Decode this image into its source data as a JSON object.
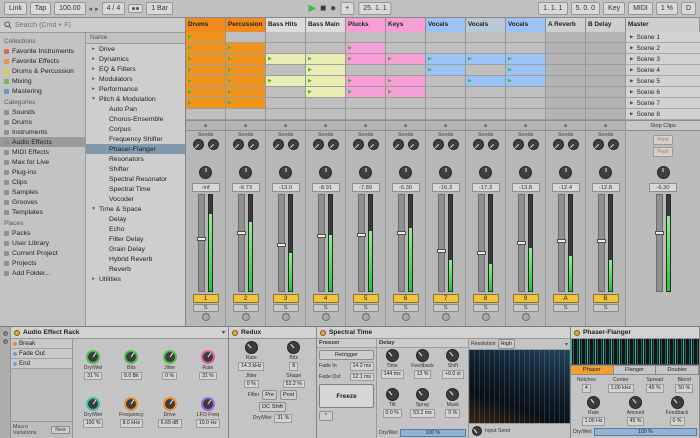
{
  "transport": {
    "link": "Link",
    "tap": "Tap",
    "tempo": "100.00",
    "nudge_down": "◂",
    "nudge_up": "▸",
    "time_sig": "4 / 4",
    "quantize_menu": "1 Bar",
    "play": "▶",
    "stop": "■",
    "record": "●",
    "overdub": "+",
    "arrangement_position": "25. 1. 1",
    "loop_start": "1. 1. 1",
    "loop_length": "5. 0. 0",
    "key_label": "Key",
    "midi_label": "MIDI",
    "cpu": "1 %",
    "disk": "D"
  },
  "browser": {
    "search_placeholder": "Search (Cmd + F)",
    "collections_label": "Collections",
    "collections": [
      {
        "label": "Favorite Instruments",
        "c": "#d66a50"
      },
      {
        "label": "Favorite Effects",
        "c": "#e89637"
      },
      {
        "label": "Drums & Percussion",
        "c": "#ddc93f"
      },
      {
        "label": "Mixing",
        "c": "#7fb25a"
      },
      {
        "label": "Mastering",
        "c": "#5e9bc8"
      }
    ],
    "categories_label": "Categories",
    "categories": [
      {
        "label": "Sounds",
        "bg": ""
      },
      {
        "label": "Drums",
        "bg": ""
      },
      {
        "label": "Instruments",
        "bg": ""
      },
      {
        "label": "Audio Effects",
        "bg": "#9a9a9a"
      },
      {
        "label": "MIDI Effects",
        "bg": ""
      },
      {
        "label": "Max for Live",
        "bg": ""
      },
      {
        "label": "Plug-ins",
        "bg": ""
      },
      {
        "label": "Clips",
        "bg": ""
      },
      {
        "label": "Samples",
        "bg": ""
      },
      {
        "label": "Grooves",
        "bg": ""
      },
      {
        "label": "Templates",
        "bg": ""
      }
    ],
    "places_label": "Places",
    "places": [
      {
        "label": "Packs"
      },
      {
        "label": "User Library"
      },
      {
        "label": "Current Project"
      },
      {
        "label": "Projects"
      },
      {
        "label": "Add Folder..."
      }
    ],
    "name_header": "Name",
    "tree": [
      {
        "label": "Drive",
        "arrow": "▸",
        "pad": "4px",
        "bg": ""
      },
      {
        "label": "Dynamics",
        "arrow": "▸",
        "pad": "4px",
        "bg": ""
      },
      {
        "label": "EQ & Filters",
        "arrow": "▸",
        "pad": "4px",
        "bg": ""
      },
      {
        "label": "Modulators",
        "arrow": "▸",
        "pad": "4px",
        "bg": ""
      },
      {
        "label": "Performance",
        "arrow": "▸",
        "pad": "4px",
        "bg": ""
      },
      {
        "label": "Pitch & Modulation",
        "arrow": "▾",
        "pad": "4px",
        "bg": ""
      },
      {
        "label": "Auto Pan",
        "arrow": "",
        "pad": "14px",
        "bg": ""
      },
      {
        "label": "Chorus-Ensemble",
        "arrow": "",
        "pad": "14px",
        "bg": ""
      },
      {
        "label": "Corpus",
        "arrow": "",
        "pad": "14px",
        "bg": ""
      },
      {
        "label": "Frequency Shifter",
        "arrow": "",
        "pad": "14px",
        "bg": ""
      },
      {
        "label": "Phaser-Flanger",
        "arrow": "",
        "pad": "14px",
        "bg": "#8298ad"
      },
      {
        "label": "Resonators",
        "arrow": "",
        "pad": "14px",
        "bg": ""
      },
      {
        "label": "Shifter",
        "arrow": "",
        "pad": "14px",
        "bg": ""
      },
      {
        "label": "Spectral Resonator",
        "arrow": "",
        "pad": "14px",
        "bg": ""
      },
      {
        "label": "Spectral Time",
        "arrow": "",
        "pad": "14px",
        "bg": ""
      },
      {
        "label": "Vocoder",
        "arrow": "",
        "pad": "14px",
        "bg": ""
      },
      {
        "label": "Time & Space",
        "arrow": "▾",
        "pad": "4px",
        "bg": ""
      },
      {
        "label": "Delay",
        "arrow": "",
        "pad": "14px",
        "bg": ""
      },
      {
        "label": "Echo",
        "arrow": "",
        "pad": "14px",
        "bg": ""
      },
      {
        "label": "Filter Delay",
        "arrow": "",
        "pad": "14px",
        "bg": ""
      },
      {
        "label": "Grain Delay",
        "arrow": "",
        "pad": "14px",
        "bg": ""
      },
      {
        "label": "Hybrid Reverb",
        "arrow": "",
        "pad": "14px",
        "bg": ""
      },
      {
        "label": "Reverb",
        "arrow": "",
        "pad": "14px",
        "bg": ""
      },
      {
        "label": "Utilities",
        "arrow": "▸",
        "pad": "4px",
        "bg": ""
      }
    ]
  },
  "session": {
    "master_header": "Master",
    "stop_clips_label": "Stop Clips",
    "tracks": [
      {
        "name": "Drums",
        "hbg": "#f08a1d",
        "clips": [
          {
            "bg": "#f0941e",
            "sym": "▶"
          },
          {
            "bg": "#f0941e",
            "sym": "▶"
          },
          {
            "bg": "#f0941e",
            "sym": "▶"
          },
          {
            "bg": "#f0941e",
            "sym": "▶"
          },
          {
            "bg": "#f0941e",
            "sym": "▶"
          },
          {
            "bg": "#f0941e",
            "sym": "▶"
          },
          {
            "bg": "#f0941e",
            "sym": "▶"
          },
          {}
        ]
      },
      {
        "name": "Percussion",
        "hbg": "#f08a1d",
        "clips": [
          {},
          {
            "bg": "#f0941e",
            "sym": "▶"
          },
          {
            "bg": "#f0941e",
            "sym": "▶"
          },
          {
            "bg": "#f0941e",
            "sym": "▶"
          },
          {
            "bg": "#f0941e",
            "sym": "▶"
          },
          {
            "bg": "#f0941e",
            "sym": "▶"
          },
          {
            "bg": "#f0941e",
            "sym": "▶"
          },
          {}
        ]
      },
      {
        "name": "Bass Hits",
        "hbg": "#dcdcdc",
        "clips": [
          {},
          {},
          {
            "bg": "#e9ecb3",
            "sym": "▶"
          },
          {},
          {
            "bg": "#e9ecb3",
            "sym": "▶"
          },
          {},
          {},
          {}
        ]
      },
      {
        "name": "Bass Main",
        "hbg": "#dcdcdc",
        "clips": [
          {},
          {},
          {
            "bg": "#e9ecb3",
            "sym": "▶"
          },
          {
            "bg": "#e9ecb3",
            "sym": "▶"
          },
          {
            "bg": "#e9ecb3",
            "sym": "▶"
          },
          {
            "bg": "#e9ecb3",
            "sym": "▶"
          },
          {},
          {}
        ]
      },
      {
        "name": "Plucks",
        "hbg": "#f59fd4",
        "clips": [
          {},
          {
            "bg": "#f59fd4",
            "sym": "▶"
          },
          {
            "bg": "#f59fd4",
            "sym": "▶"
          },
          {},
          {
            "bg": "#f59fd4",
            "sym": "▶"
          },
          {
            "bg": "#f59fd4",
            "sym": "▶"
          },
          {},
          {}
        ]
      },
      {
        "name": "Keys",
        "hbg": "#f59fd4",
        "clips": [
          {},
          {},
          {
            "bg": "#f59fd4",
            "sym": "▶"
          },
          {},
          {
            "bg": "#f59fd4",
            "sym": "▶"
          },
          {
            "bg": "#f59fd4",
            "sym": "▶"
          },
          {},
          {}
        ]
      },
      {
        "name": "Vocals",
        "hbg": "#9cc3f5",
        "clips": [
          {},
          {},
          {
            "bg": "#9cc3f5",
            "sym": "▶"
          },
          {
            "bg": "#9cc3f5",
            "sym": "▶"
          },
          {},
          {},
          {},
          {}
        ]
      },
      {
        "name": "Vocals",
        "hbg": "#b9c7d6",
        "clips": [
          {},
          {},
          {
            "bg": "#9cc3f5",
            "sym": "▶"
          },
          {},
          {
            "bg": "#9cc3f5",
            "sym": "▶"
          },
          {},
          {},
          {}
        ]
      },
      {
        "name": "Vocals",
        "hbg": "#9cc3f5",
        "clips": [
          {},
          {},
          {
            "bg": "#9cc3f5",
            "sym": "▶"
          },
          {
            "bg": "#9cc3f5",
            "sym": "▶"
          },
          {
            "bg": "#9cc3f5",
            "sym": "▶"
          },
          {},
          {},
          {}
        ]
      },
      {
        "name": "A Reverb",
        "hbg": "#cfcfcf",
        "clips": [
          {
            "bg": "#b3b3b3"
          },
          {
            "bg": "#b3b3b3"
          },
          {
            "bg": "#b3b3b3"
          },
          {
            "bg": "#b3b3b3"
          },
          {
            "bg": "#b3b3b3"
          },
          {
            "bg": "#b3b3b3"
          },
          {
            "bg": "#b3b3b3"
          },
          {
            "bg": "#b3b3b3"
          }
        ]
      },
      {
        "name": "B Delay",
        "hbg": "#cfcfcf",
        "clips": [
          {
            "bg": "#b3b3b3"
          },
          {
            "bg": "#b3b3b3"
          },
          {
            "bg": "#b3b3b3"
          },
          {
            "bg": "#b3b3b3"
          },
          {
            "bg": "#b3b3b3"
          },
          {
            "bg": "#b3b3b3"
          },
          {
            "bg": "#b3b3b3"
          },
          {
            "bg": "#b3b3b3"
          }
        ]
      }
    ],
    "scenes": [
      {
        "label": "Scene 1"
      },
      {
        "label": "Scene 2"
      },
      {
        "label": "Scene 3"
      },
      {
        "label": "Scene 4"
      },
      {
        "label": "Scene 5"
      },
      {
        "label": "Scene 6"
      },
      {
        "label": "Scene 7"
      },
      {
        "label": "Scene 8"
      }
    ]
  },
  "mixer": {
    "sends_label": "Sends",
    "solo_label": "S",
    "strips": [
      {
        "num": "1",
        "db": "-Inf",
        "meter": "80%",
        "fader": "52%",
        "armvis": "visible"
      },
      {
        "num": "2",
        "db": "-6.73",
        "meter": "72%",
        "fader": "58%",
        "armvis": "visible"
      },
      {
        "num": "3",
        "db": "-13.0",
        "meter": "40%",
        "fader": "46%",
        "armvis": "visible"
      },
      {
        "num": "4",
        "db": "-8.91",
        "meter": "58%",
        "fader": "55%",
        "armvis": "visible"
      },
      {
        "num": "5",
        "db": "-7.89",
        "meter": "62%",
        "fader": "56%",
        "armvis": "visible"
      },
      {
        "num": "6",
        "db": "-6.30",
        "meter": "66%",
        "fader": "58%",
        "armvis": "visible"
      },
      {
        "num": "7",
        "db": "-16.3",
        "meter": "32%",
        "fader": "40%",
        "armvis": "visible"
      },
      {
        "num": "8",
        "db": "-17.3",
        "meter": "28%",
        "fader": "38%",
        "armvis": "visible"
      },
      {
        "num": "9",
        "db": "-13.8",
        "meter": "45%",
        "fader": "48%",
        "armvis": "visible"
      },
      {
        "num": "A",
        "db": "-12.4",
        "meter": "36%",
        "fader": "50%",
        "armvis": "hidden"
      },
      {
        "num": "B",
        "db": "-12.8",
        "meter": "32%",
        "fader": "50%",
        "armvis": "hidden"
      }
    ],
    "master": {
      "post_a": "Post",
      "post_b": "Post",
      "db": "-6.30",
      "meter": "78%",
      "fader": "58%"
    }
  },
  "detail": {
    "rack": {
      "title": "Audio Effect Rack",
      "chains": [
        {
          "name": "Break",
          "dot": "#e8883a"
        },
        {
          "name": "Fade Out",
          "dot": "#6aa1d8"
        },
        {
          "name": "End",
          "dot": "#6aa1d8"
        }
      ],
      "macro_variations_label": "Macro Variations",
      "variation_new_label": "New",
      "macros": [
        {
          "label": "Dry/Wet",
          "value": "31 %",
          "c": "#4cbf4c"
        },
        {
          "label": "Bits",
          "value": "8.0 Bit",
          "c": "#4cbf4c"
        },
        {
          "label": "Jitter",
          "value": "0 %",
          "c": "#4cbf4c"
        },
        {
          "label": "Rate",
          "value": "31 %",
          "c": "#e060a0"
        },
        {
          "label": "Dry/Wet",
          "value": "100 %",
          "c": "#3cbfb0"
        },
        {
          "label": "Frequency",
          "value": "8.0 kHz",
          "c": "#f09030"
        },
        {
          "label": "Drive",
          "value": "6.69 dB",
          "c": "#f09030"
        },
        {
          "label": "LFO Freq",
          "value": "10.0 Hz",
          "c": "#9a6ad8"
        }
      ]
    },
    "redux": {
      "title": "Redux",
      "rate_label": "Rate",
      "rate_value": "14.3 kHz",
      "bits_label": "Bits",
      "bits_value": "8",
      "jitter_label": "Jitter",
      "jitter_value": "0 %",
      "shape_label": "Shape",
      "shape_value": "53.2 %",
      "filter_label": "Filter",
      "pre_label": "Pre",
      "post_label": "Post",
      "dc_label": "DC Shift",
      "drywet_label": "Dry/Wet",
      "drywet_value": "31 %"
    },
    "spectral": {
      "title": "Spectral Time",
      "freezer_header": "Freezer",
      "retrigger_label": "Retrigger",
      "fade_in_label": "Fade In",
      "fade_in_value": "14.2 ms",
      "fade_out_label": "Fade Out",
      "fade_out_value": "12.1 ms",
      "freeze_label": "Freeze",
      "sync_label": "*",
      "delay_header": "Delay",
      "knobs": [
        {
          "label": "Time",
          "value": "144 ms"
        },
        {
          "label": "Feedback",
          "value": "13 %"
        },
        {
          "label": "Shift",
          "value": "+0.0 st"
        },
        {
          "label": "Tilt",
          "value": "0.0 %"
        },
        {
          "label": "Spray",
          "value": "53.2 ms"
        },
        {
          "label": "Mask",
          "value": "0 %"
        }
      ],
      "drywet_label": "Dry/Wet",
      "drywet_value": "100 %",
      "resolution_label": "Resolution",
      "resolution_value": "High",
      "input_send_label": "Input Send"
    },
    "phaser": {
      "title": "Phaser-Flanger",
      "tabs": [
        {
          "label": "Phaser",
          "bg": "#f0a030"
        },
        {
          "label": "Flanger",
          "bg": ""
        },
        {
          "label": "Doubler",
          "bg": ""
        }
      ],
      "params": [
        {
          "label": "Notches",
          "value": "4"
        },
        {
          "label": "Center",
          "value": "1.00 kHz"
        },
        {
          "label": "Spread",
          "value": "45 %"
        },
        {
          "label": "Blend",
          "value": "50 %"
        }
      ],
      "knobs": [
        {
          "label": "Rate",
          "value": "1.00 Hz"
        },
        {
          "label": "Amount",
          "value": "45 %"
        },
        {
          "label": "Feedback",
          "value": "0 %"
        }
      ],
      "drywet_label": "Dry/Wet",
      "drywet_value": "100 %"
    }
  }
}
